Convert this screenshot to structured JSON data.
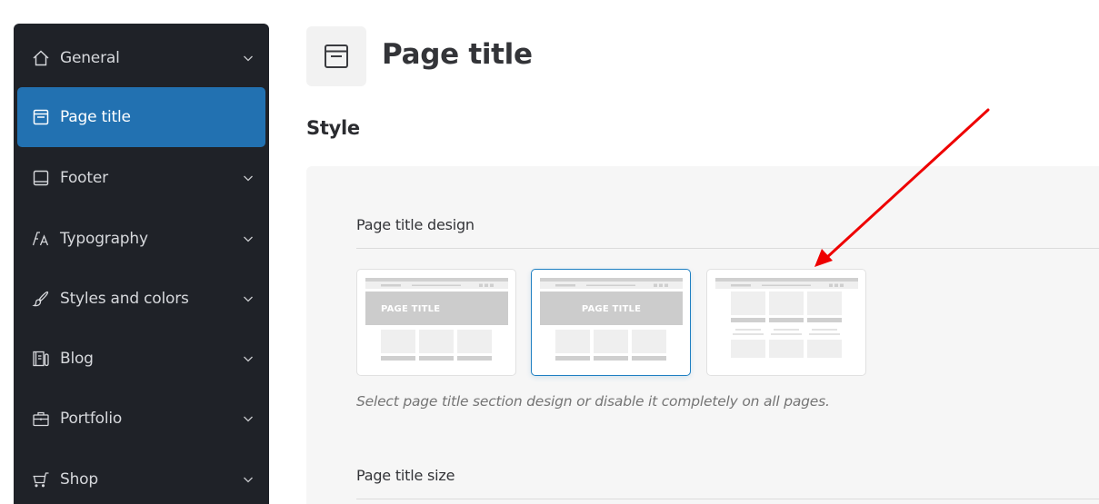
{
  "sidebar": {
    "items": [
      {
        "label": "General",
        "icon": "home-icon",
        "has_chevron": true,
        "active": false
      },
      {
        "label": "Page title",
        "icon": "page-title-icon",
        "has_chevron": false,
        "active": true
      },
      {
        "label": "Footer",
        "icon": "footer-icon",
        "has_chevron": true,
        "active": false
      },
      {
        "label": "Typography",
        "icon": "typography-icon",
        "has_chevron": true,
        "active": false
      },
      {
        "label": "Styles and colors",
        "icon": "brush-icon",
        "has_chevron": true,
        "active": false
      },
      {
        "label": "Blog",
        "icon": "blog-icon",
        "has_chevron": true,
        "active": false
      },
      {
        "label": "Portfolio",
        "icon": "briefcase-icon",
        "has_chevron": true,
        "active": false
      },
      {
        "label": "Shop",
        "icon": "cart-icon",
        "has_chevron": true,
        "active": false
      }
    ]
  },
  "header": {
    "title": "Page title",
    "icon": "page-title-icon"
  },
  "main": {
    "section_title": "Style",
    "design_field": {
      "label": "Page title design",
      "options": [
        {
          "name": "left-aligned",
          "thumb_text": "PAGE TITLE",
          "selected": false
        },
        {
          "name": "centered",
          "thumb_text": "PAGE TITLE",
          "selected": true
        },
        {
          "name": "disabled",
          "thumb_text": "",
          "selected": false
        }
      ],
      "help_text": "Select page title section design or disable it completely on all pages."
    },
    "size_field": {
      "label": "Page title size"
    }
  },
  "colors": {
    "sidebar_bg": "#1f2228",
    "active_item": "#2271b1",
    "selected_border": "#1e7fc2",
    "annotation_arrow": "#ee0000"
  }
}
